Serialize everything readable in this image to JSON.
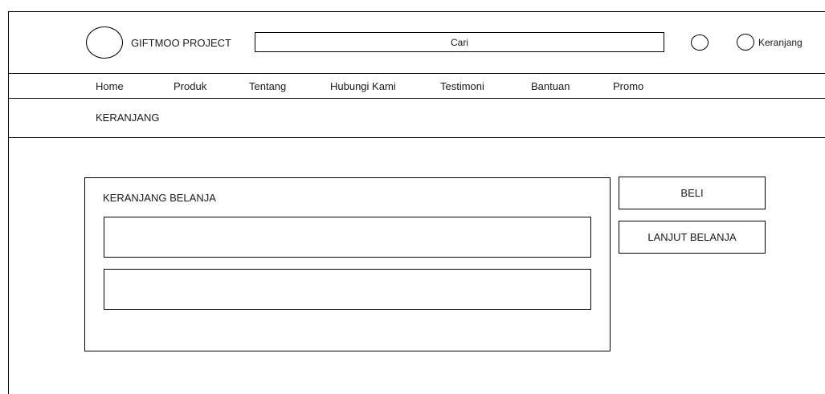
{
  "header": {
    "brand": "GIFTMOO PROJECT",
    "search_placeholder": "Cari",
    "cart_label": "Keranjang"
  },
  "nav": {
    "items": [
      "Home",
      "Produk",
      "Tentang",
      "Hubungi Kami",
      "Testimoni",
      "Bantuan",
      "Promo"
    ]
  },
  "breadcrumb": {
    "title": "KERANJANG"
  },
  "cart": {
    "heading": "KERANJANG BELANJA",
    "items": [
      "",
      ""
    ]
  },
  "actions": {
    "buy_label": "BELI",
    "continue_label": "LANJUT BELANJA"
  }
}
